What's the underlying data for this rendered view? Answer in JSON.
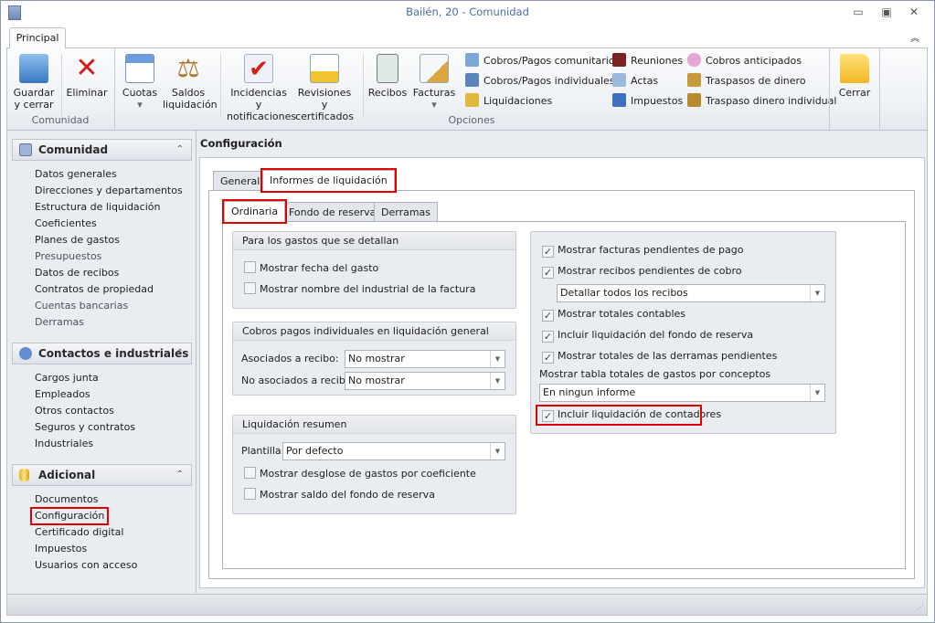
{
  "window": {
    "title": "Bailén, 20 - Comunidad",
    "minimize": "▭",
    "restore": "▣",
    "close": "✕"
  },
  "ribbon": {
    "tab": "Principal",
    "collapse": "︽",
    "groups": {
      "comunidad": "Comunidad",
      "opciones": "Opciones"
    },
    "buttons": {
      "guardar": "Guardar y cerrar",
      "eliminar": "Eliminar",
      "cuotas": "Cuotas",
      "saldos": "Saldos liquidación",
      "incidencias": "Incidencias y notificaciones",
      "revisiones": "Revisiones y certificados",
      "recibos": "Recibos",
      "facturas": "Facturas",
      "cerrar": "Cerrar",
      "dropdown": "▾"
    },
    "small": [
      "Cobros/Pagos comunitarios",
      "Cobros/Pagos individuales",
      "Liquidaciones",
      "Reuniones",
      "Actas",
      "Impuestos",
      "Cobros anticipados",
      "Traspasos de dinero",
      "Traspaso dinero individual"
    ]
  },
  "sidebar": {
    "chevron": "⌃",
    "sections": [
      {
        "title": "Comunidad",
        "items": [
          "Datos generales",
          "Direcciones y departamentos",
          "Estructura de liquidación",
          "Coeficientes",
          "Planes de gastos",
          "Presupuestos",
          "Datos de recibos",
          "Contratos de propiedad",
          "Cuentas bancarias",
          "Derramas"
        ]
      },
      {
        "title": "Contactos e industriales",
        "items": [
          "Cargos junta",
          "Empleados",
          "Otros contactos",
          "Seguros y contratos",
          "Industriales"
        ]
      },
      {
        "title": "Adicional",
        "items": [
          "Documentos",
          "Configuración",
          "Certificado digital",
          "Impuestos",
          "Usuarios con acceso"
        ]
      }
    ]
  },
  "main": {
    "title": "Configuración",
    "tabs": [
      "General",
      "Informes de liquidación"
    ],
    "subtabs": [
      "Ordinaria",
      "Fondo de reserva",
      "Derramas"
    ],
    "group1": {
      "title": "Para los gastos que se detallan",
      "checks": [
        {
          "label": "Mostrar fecha del gasto",
          "checked": false
        },
        {
          "label": "Mostrar nombre del industrial de la factura",
          "checked": false
        }
      ]
    },
    "group2": {
      "title": "Cobros pagos individuales en liquidación general",
      "asociados_label": "Asociados a recibo:",
      "asociados_value": "No mostrar",
      "no_asociados_label": "No asociados a recibo:",
      "no_asociados_value": "No mostrar"
    },
    "group3": {
      "title": "Liquidación resumen",
      "plantilla_label": "Plantilla:",
      "plantilla_value": "Por defecto",
      "checks": [
        {
          "label": "Mostrar desglose de gastos por coeficiente",
          "checked": false
        },
        {
          "label": "Mostrar saldo del fondo de reserva",
          "checked": false
        }
      ]
    },
    "right": {
      "c1": "Mostrar facturas pendientes de pago",
      "c2": "Mostrar recibos pendientes de cobro",
      "recibos_combo": "Detallar todos los recibos",
      "c3": "Mostrar totales contables",
      "c4": "Incluir liquidación del fondo de reserva",
      "c5": "Mostrar totales de las derramas pendientes",
      "tabla_label": "Mostrar tabla totales de gastos por conceptos",
      "tabla_combo": "En ningun informe",
      "c6": "Incluir liquidación de contadores",
      "check": "✓"
    }
  }
}
